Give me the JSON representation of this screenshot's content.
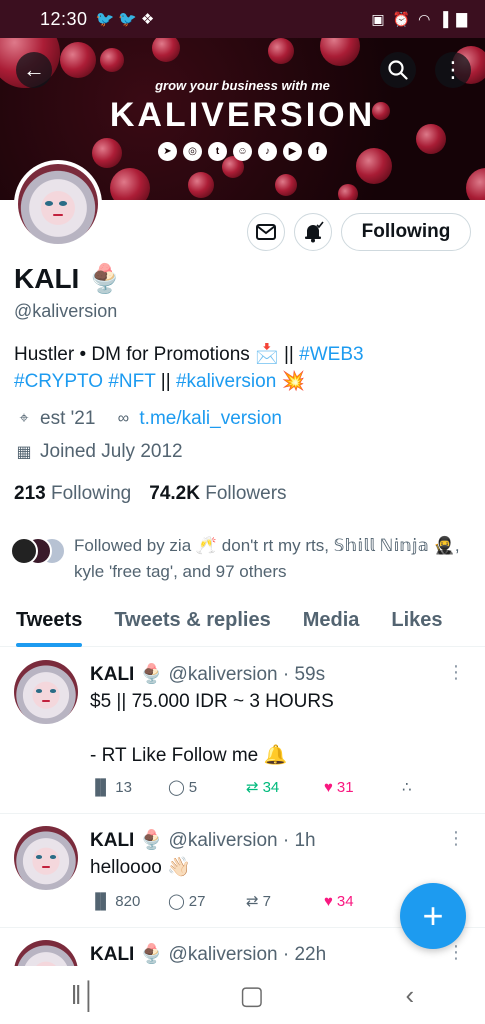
{
  "status_bar": {
    "time": "12:30",
    "left_icons": [
      "twitter-icon",
      "twitter-icon",
      "slack-icon"
    ],
    "right_icons": [
      "battery-saver-icon",
      "alarm-icon",
      "wifi-icon",
      "signal-icon",
      "battery-icon"
    ]
  },
  "banner": {
    "tagline": "grow your business with me",
    "brand": "KALIVERSION",
    "social_icons": [
      "telegram-icon",
      "instagram-icon",
      "twitter-icon",
      "discord-icon",
      "tiktok-icon",
      "youtube-icon",
      "facebook-icon"
    ]
  },
  "profile": {
    "name": "KALI 🍨",
    "handle": "@kaliversion",
    "bio_text": "Hustler • DM for Promotions 📩 || ",
    "bio_tag1": "#WEB3",
    "bio_tag2": "#CRYPTO",
    "bio_tag3": "#NFT",
    "bio_sep": " || ",
    "bio_tag4": "#kaliversion",
    "bio_end": " 💥",
    "location": "est '21",
    "url": "t.me/kali_version",
    "joined": "Joined July 2012",
    "following_count": "213",
    "following_label": "Following",
    "followers_count": "74.2K",
    "followers_label": "Followers",
    "followed_by": "Followed by zia 🥂 don't rt my rts, 𝕊𝕙𝕚𝕝𝕝 ℕ𝕚𝕟𝕛𝕒 🥷, kyle 'free tag', and 97 others"
  },
  "actions": {
    "follow_label": "Following"
  },
  "tabs": [
    "Tweets",
    "Tweets & replies",
    "Media",
    "Likes"
  ],
  "tweets": [
    {
      "name": "KALI 🍨",
      "meta": "@kaliversion · 59s",
      "body": "$5 || 75.000 IDR ~ 3 HOURS\n\n- RT Like Follow me 🔔",
      "views": "13",
      "replies": "5",
      "retweets": "34",
      "likes": "31"
    },
    {
      "name": "KALI 🍨",
      "meta": "@kaliversion · 1h",
      "body": "helloooo 👋🏻",
      "views": "820",
      "replies": "27",
      "retweets": "7",
      "likes": "34"
    },
    {
      "name": "KALI 🍨",
      "meta": "@kaliversion · 22h"
    }
  ],
  "colors": {
    "accent": "#1d9bf0",
    "status_bar": "#3b0f1f",
    "retweet": "#00ba7c",
    "like": "#f91880"
  }
}
